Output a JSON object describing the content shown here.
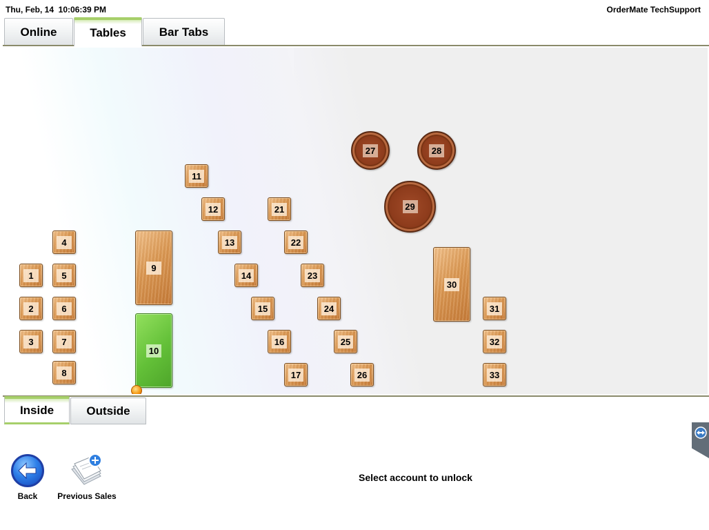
{
  "status": {
    "datetime": "Thu, Feb, 14  10:06:39 PM",
    "user": "OrderMate TechSupport"
  },
  "top_tabs": [
    {
      "label": "Online",
      "active": false
    },
    {
      "label": "Tables",
      "active": true
    },
    {
      "label": "Bar Tabs",
      "active": false
    }
  ],
  "area_tabs": [
    {
      "label": "Inside",
      "active": true
    },
    {
      "label": "Outside",
      "active": false
    }
  ],
  "tables": [
    {
      "number": "1",
      "shape": "square",
      "state": "free"
    },
    {
      "number": "2",
      "shape": "square",
      "state": "free"
    },
    {
      "number": "3",
      "shape": "square",
      "state": "free"
    },
    {
      "number": "4",
      "shape": "square",
      "state": "free"
    },
    {
      "number": "5",
      "shape": "square",
      "state": "free"
    },
    {
      "number": "6",
      "shape": "square",
      "state": "free"
    },
    {
      "number": "7",
      "shape": "square",
      "state": "free"
    },
    {
      "number": "8",
      "shape": "square",
      "state": "free"
    },
    {
      "number": "9",
      "shape": "long",
      "state": "free"
    },
    {
      "number": "10",
      "shape": "long",
      "state": "occupied"
    },
    {
      "number": "11",
      "shape": "square",
      "state": "free"
    },
    {
      "number": "12",
      "shape": "square",
      "state": "free"
    },
    {
      "number": "13",
      "shape": "square",
      "state": "free"
    },
    {
      "number": "14",
      "shape": "square",
      "state": "free"
    },
    {
      "number": "15",
      "shape": "square",
      "state": "free"
    },
    {
      "number": "16",
      "shape": "square",
      "state": "free"
    },
    {
      "number": "17",
      "shape": "square",
      "state": "free"
    },
    {
      "number": "21",
      "shape": "square",
      "state": "free"
    },
    {
      "number": "22",
      "shape": "square",
      "state": "free"
    },
    {
      "number": "23",
      "shape": "square",
      "state": "free"
    },
    {
      "number": "24",
      "shape": "square",
      "state": "free"
    },
    {
      "number": "25",
      "shape": "square",
      "state": "free"
    },
    {
      "number": "26",
      "shape": "square",
      "state": "free"
    },
    {
      "number": "27",
      "shape": "round",
      "state": "free"
    },
    {
      "number": "28",
      "shape": "round",
      "state": "free"
    },
    {
      "number": "29",
      "shape": "round",
      "state": "free"
    },
    {
      "number": "30",
      "shape": "long",
      "state": "free"
    },
    {
      "number": "31",
      "shape": "square",
      "state": "free"
    },
    {
      "number": "32",
      "shape": "square",
      "state": "free"
    },
    {
      "number": "33",
      "shape": "square",
      "state": "free"
    }
  ],
  "colors": {
    "wood": "#dc9a55",
    "round_wood": "#8e3c1c",
    "occupied": "#63c038",
    "tab_accent": "#a6cf6a"
  },
  "actions": {
    "back_label": "Back",
    "back_icon": "back-arrow-icon",
    "previous_sales_label": "Previous Sales",
    "previous_sales_icon": "previous-sales-icon"
  },
  "message": "Select account to unlock",
  "side_handle_icon": "remote-support-icon"
}
